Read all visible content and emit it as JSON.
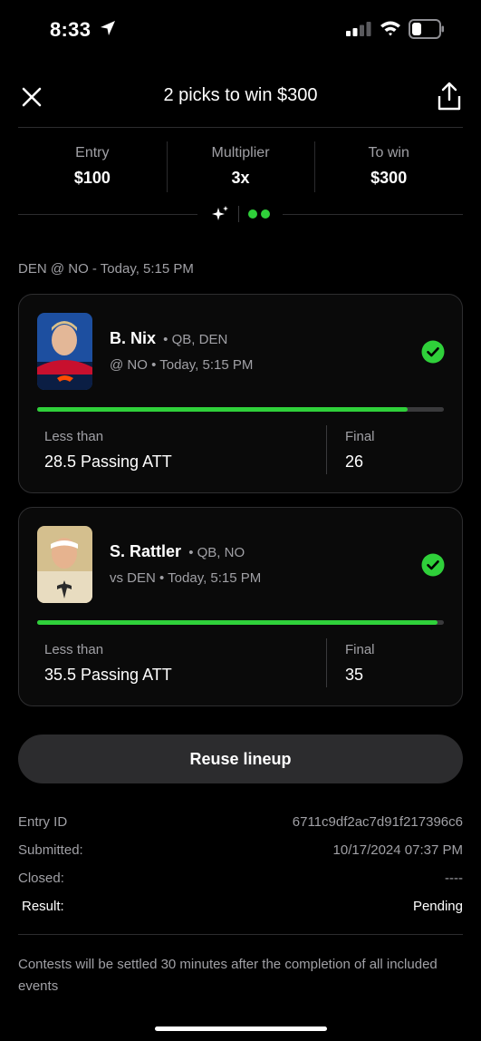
{
  "status_bar": {
    "time": "8:33"
  },
  "header": {
    "title": "2 picks to win $300"
  },
  "stats": [
    {
      "label": "Entry",
      "value": "$100"
    },
    {
      "label": "Multiplier",
      "value": "3x"
    },
    {
      "label": "To win",
      "value": "$300"
    }
  ],
  "game_info": "DEN @ NO - Today, 5:15 PM",
  "picks": [
    {
      "name": "B. Nix",
      "position": "QB, DEN",
      "game": "@ NO",
      "time": "Today, 5:15 PM",
      "direction": "Less than",
      "line": "28.5 Passing ATT",
      "final_label": "Final",
      "final_value": "26",
      "progress": 0.91
    },
    {
      "name": "S. Rattler",
      "position": "QB, NO",
      "game": "vs DEN",
      "time": "Today, 5:15 PM",
      "direction": "Less than",
      "line": "35.5 Passing ATT",
      "final_label": "Final",
      "final_value": "35",
      "progress": 0.985
    }
  ],
  "reuse_button": "Reuse lineup",
  "entry_details": {
    "entry_id_label": "Entry ID",
    "entry_id": "6711c9df2ac7d91f217396c6",
    "submitted_label": "Submitted:",
    "submitted": "10/17/2024 07:37 PM",
    "closed_label": "Closed:",
    "closed": "----",
    "result_label": "Result:",
    "result": "Pending"
  },
  "footnote": "Contests will be settled 30 minutes after the completion of all included events",
  "colors": {
    "accent_green": "#2fd03a",
    "background": "#000000",
    "card_border": "#2e2e30"
  },
  "icons": [
    "location-arrow-icon",
    "signal-icon",
    "wifi-icon",
    "battery-icon",
    "close-icon",
    "share-icon",
    "sparkle-icon",
    "status-dots-icon",
    "check-circle-icon"
  ]
}
